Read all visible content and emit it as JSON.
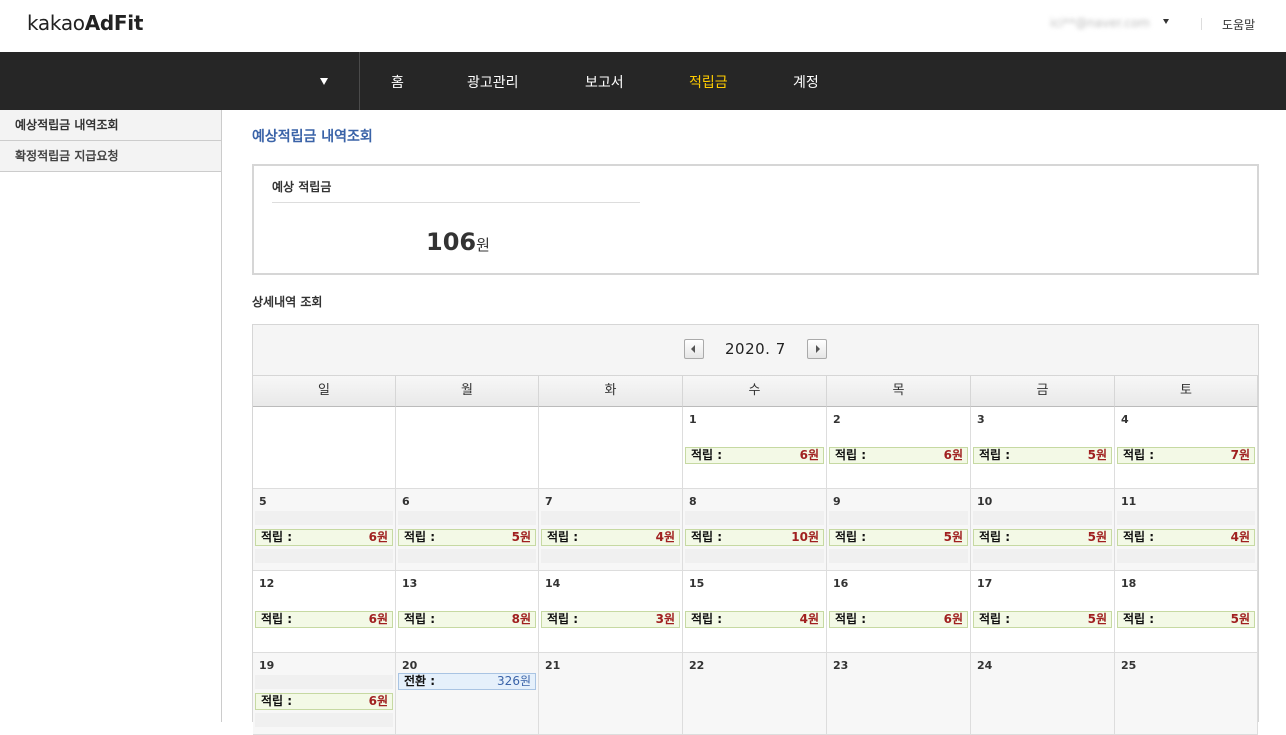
{
  "header": {
    "logo_prefix": "kakao",
    "logo_bold": "AdFit",
    "user": "ici**@naver.com",
    "help": "도움말"
  },
  "nav": {
    "items": [
      {
        "label": "홈",
        "active": false
      },
      {
        "label": "광고관리",
        "active": false
      },
      {
        "label": "보고서",
        "active": false
      },
      {
        "label": "적립금",
        "active": true
      },
      {
        "label": "계정",
        "active": false
      }
    ]
  },
  "sidebar": {
    "items": [
      {
        "label": "예상적립금 내역조회",
        "active": true
      },
      {
        "label": "확정적립금 지급요청",
        "active": false
      }
    ]
  },
  "main": {
    "title": "예상적립금 내역조회",
    "estimate_label": "예상 적립금",
    "estimate_value": "106",
    "estimate_unit": "원",
    "detail_label": "상세내역 조회"
  },
  "calendar": {
    "month_label": "2020. 7",
    "weekdays": [
      "일",
      "월",
      "화",
      "수",
      "목",
      "금",
      "토"
    ],
    "earn_label": "적립 :",
    "convert_label": "전환 :",
    "weeks": [
      [
        null,
        null,
        null,
        {
          "day": "1",
          "earn": "6원"
        },
        {
          "day": "2",
          "earn": "6원"
        },
        {
          "day": "3",
          "earn": "5원"
        },
        {
          "day": "4",
          "earn": "7원"
        }
      ],
      [
        {
          "day": "5",
          "earn": "6원"
        },
        {
          "day": "6",
          "earn": "5원"
        },
        {
          "day": "7",
          "earn": "4원"
        },
        {
          "day": "8",
          "earn": "10원"
        },
        {
          "day": "9",
          "earn": "5원"
        },
        {
          "day": "10",
          "earn": "5원"
        },
        {
          "day": "11",
          "earn": "4원"
        }
      ],
      [
        {
          "day": "12",
          "earn": "6원"
        },
        {
          "day": "13",
          "earn": "8원"
        },
        {
          "day": "14",
          "earn": "3원"
        },
        {
          "day": "15",
          "earn": "4원"
        },
        {
          "day": "16",
          "earn": "6원"
        },
        {
          "day": "17",
          "earn": "5원"
        },
        {
          "day": "18",
          "earn": "5원"
        }
      ],
      [
        {
          "day": "19",
          "earn": "6원"
        },
        {
          "day": "20",
          "convert": "326원"
        },
        {
          "day": "21"
        },
        {
          "day": "22"
        },
        {
          "day": "23"
        },
        {
          "day": "24"
        },
        {
          "day": "25"
        }
      ]
    ]
  },
  "colors": {
    "nav_bg": "#262626",
    "nav_active": "#ffcc00",
    "title_blue": "#3a63a8",
    "earn_value": "#a02020"
  }
}
